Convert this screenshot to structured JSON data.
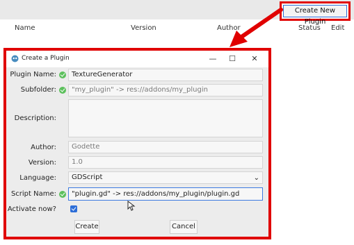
{
  "top_button": {
    "label": "Create New Plugin"
  },
  "columns": {
    "name": "Name",
    "version": "Version",
    "author": "Author",
    "status": "Status",
    "edit": "Edit"
  },
  "dialog": {
    "title": "Create a Plugin",
    "controls": {
      "minimize": "—",
      "maximize": "☐",
      "close": "✕"
    },
    "fields": {
      "plugin_name": {
        "label": "Plugin Name:",
        "value": "TextureGenerator"
      },
      "subfolder": {
        "label": "Subfolder:",
        "value": "\"my_plugin\" -> res://addons/my_plugin"
      },
      "description": {
        "label": "Description:",
        "value": ""
      },
      "author": {
        "label": "Author:",
        "placeholder": "Godette"
      },
      "version": {
        "label": "Version:",
        "placeholder": "1.0"
      },
      "language": {
        "label": "Language:",
        "value": "GDScript"
      },
      "script_name": {
        "label": "Script Name:",
        "value": "\"plugin.gd\" -> res://addons/my_plugin/plugin.gd"
      },
      "activate": {
        "label": "Activate now?",
        "checked": true
      }
    },
    "buttons": {
      "create": "Create",
      "cancel": "Cancel"
    }
  },
  "colors": {
    "highlight": "#e00000",
    "valid": "#5cc05c",
    "accent": "#2d6ed8"
  }
}
